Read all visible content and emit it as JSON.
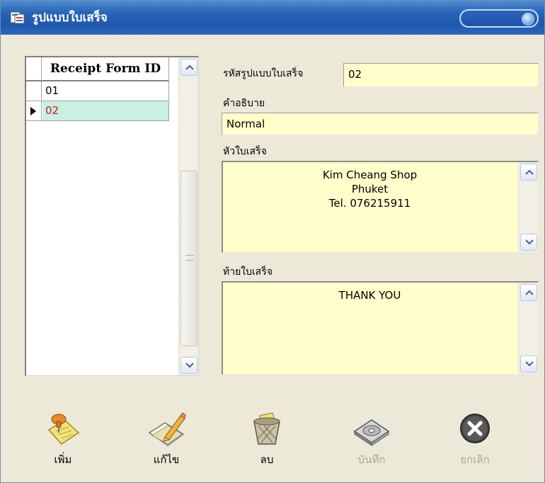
{
  "window": {
    "title": "รูปแบบใบเสร็จ"
  },
  "grid": {
    "column_header": "Receipt Form ID",
    "rows": [
      {
        "id": "01",
        "selected": false
      },
      {
        "id": "02",
        "selected": true
      }
    ]
  },
  "form": {
    "code_label": "รหัสรูปแบบใบเสร็จ",
    "code_value": "02",
    "description_label": "คำอธิบาย",
    "description_value": "Normal",
    "header_label": "หัวใบเสร็จ",
    "header_text": "Kim Cheang Shop\nPhuket\nTel. 076215911",
    "footer_label": "ท้ายใบเสร็จ",
    "footer_text": "THANK YOU"
  },
  "toolbar": {
    "add_label": "เพิ่ม",
    "edit_label": "แก้ไข",
    "delete_label": "ลบ",
    "save_label": "บันทึก",
    "cancel_label": "ยกเลิก"
  },
  "colors": {
    "field_bg": "#ffffcc",
    "selected_row_bg": "#c8f0e4",
    "selected_row_text": "#cc1a10",
    "disabled_text": "#aca899"
  },
  "icons": {
    "title": "form-window-icon",
    "add": "pushpin-note-icon",
    "edit": "pencil-paper-icon",
    "delete": "wastebasket-icon",
    "save": "disk-save-icon",
    "cancel": "cancel-x-icon"
  }
}
